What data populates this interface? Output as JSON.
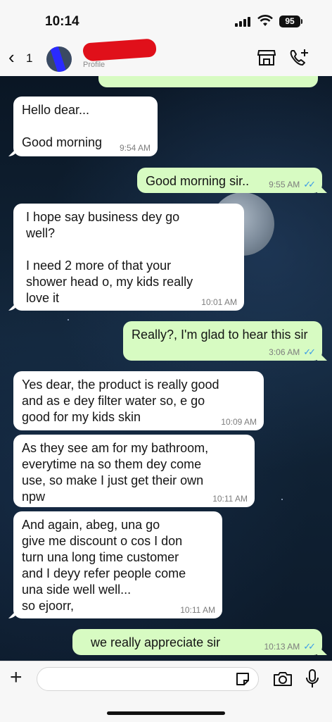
{
  "status_bar": {
    "time": "10:14",
    "battery": "95"
  },
  "header": {
    "back_count": "1",
    "contact_sub": "Profile"
  },
  "messages": [
    {
      "dir": "in",
      "text": "Hello dear...\n\nGood morning",
      "time": "9:54 AM"
    },
    {
      "dir": "out",
      "text": "Good morning sir..",
      "time": "9:55 AM"
    },
    {
      "dir": "in",
      "text": "I hope say business dey go\nwell?\n\nI need 2 more of that your\nshower head o, my kids really\nlove it",
      "time": "10:01 AM"
    },
    {
      "dir": "out",
      "text": "Really?, I'm glad to hear this sir",
      "time": "3:06 AM"
    },
    {
      "dir": "in",
      "text": "Yes dear, the product is really good\nand as e dey filter water so, e go\ngood for my kids skin",
      "time": "10:09 AM"
    },
    {
      "dir": "in",
      "text": "As they see am for my bathroom,\neverytime na so them dey come\nuse, so make I just get their own\nnpw",
      "time": "10:11 AM"
    },
    {
      "dir": "in",
      "text": "And again, abeg, una go\ngive me discount o cos I don\nturn una long time customer\nand I deyy refer people come\nuna side well well...\nso ejoorr,",
      "time": "10:11 AM"
    },
    {
      "dir": "out",
      "text": "we really appreciate sir",
      "time": "10:13 AM"
    }
  ],
  "input": {
    "placeholder": ""
  },
  "colors": {
    "incoming": "#ffffff",
    "outgoing": "#d7fbc2",
    "read_ticks": "#3a9be8"
  }
}
